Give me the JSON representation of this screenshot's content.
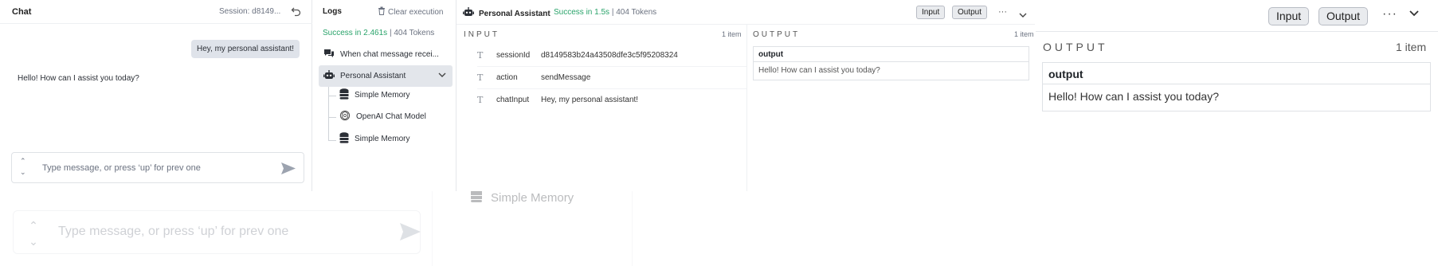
{
  "background": {
    "input_placeholder": "Type message, or press ‘up’ for prev one",
    "memory_label": "Simple Memory"
  },
  "right_panel": {
    "input_button": "Input",
    "output_button": "Output",
    "more_label": "···",
    "section_label": "OUTPUT",
    "count": "1 item",
    "column_header": "output",
    "value": "Hello! How can I assist you today?"
  },
  "chat": {
    "title": "Chat",
    "session": "Session: d8149...",
    "user_message": "Hey, my personal assistant!",
    "bot_message": "Hello! How can I assist you today?",
    "input_placeholder": "Type message, or press ‘up’ for prev one"
  },
  "logs": {
    "title": "Logs",
    "clear_label": "Clear execution",
    "status_prefix": "Success in 2.461s",
    "status_separator": " | ",
    "status_tokens": "404 Tokens",
    "items": [
      {
        "label": "When chat message recei...",
        "icon": "chat-bubbles-icon"
      },
      {
        "label": "Personal Assistant",
        "icon": "robot-icon"
      },
      {
        "label": "Simple Memory",
        "icon": "database-icon"
      },
      {
        "label": "OpenAI Chat Model",
        "icon": "openai-icon"
      },
      {
        "label": "Simple Memory",
        "icon": "database-icon"
      }
    ]
  },
  "detail": {
    "title": "Personal Assistant",
    "status": "Success in 1.5s",
    "separator": " | ",
    "tokens": "404 Tokens",
    "input_button": "Input",
    "output_button": "Output",
    "more_label": "···",
    "input_label": "INPUT",
    "input_count": "1 item",
    "output_label": "OUTPUT",
    "output_count": "1 item",
    "fields": [
      {
        "key": "sessionId",
        "value": "d8149583b24a43508dfe3c5f95208324"
      },
      {
        "key": "action",
        "value": "sendMessage"
      },
      {
        "key": "chatInput",
        "value": "Hey, my personal assistant!"
      }
    ],
    "output_header": "output",
    "output_value": "Hello! How can I assist you today?"
  },
  "colors": {
    "success": "#29a36a",
    "selected_bg": "#e3e6eb",
    "user_bubble": "#dfe3ea"
  }
}
